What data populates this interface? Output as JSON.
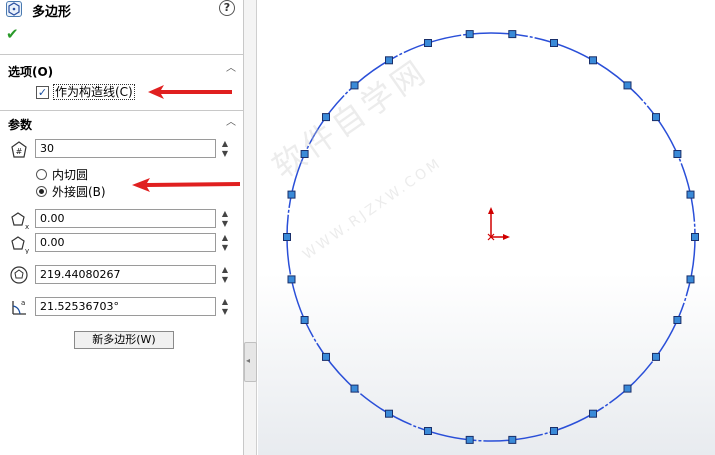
{
  "panel": {
    "title": "多边形",
    "help_label": "?",
    "ok_symbol": "✔",
    "options_section": {
      "title": "选项(O)",
      "construction_checkbox_label": "作为构造线(C)",
      "construction_checked": true
    },
    "params_section": {
      "title": "参数",
      "sides_value": "30",
      "inscribed_label": "内切圆",
      "circumscribed_label": "外接圆(B)",
      "selected_mode": "circumscribed",
      "center_x_value": "0.00",
      "center_y_value": "0.00",
      "diameter_value": "219.44080267",
      "angle_value": "21.52536703°",
      "new_polygon_label": "新多边形(W)"
    }
  },
  "canvas": {
    "polygon_sides": 30,
    "circle_color": "#2a4fd8",
    "vertex_color": "#3a8ad8",
    "origin_color": "#d00000"
  },
  "annotations": {
    "arrow_color": "#e02020"
  },
  "watermark": {
    "main_text": "软件自学网",
    "sub_text": "WWW.RJZXW.COM"
  }
}
